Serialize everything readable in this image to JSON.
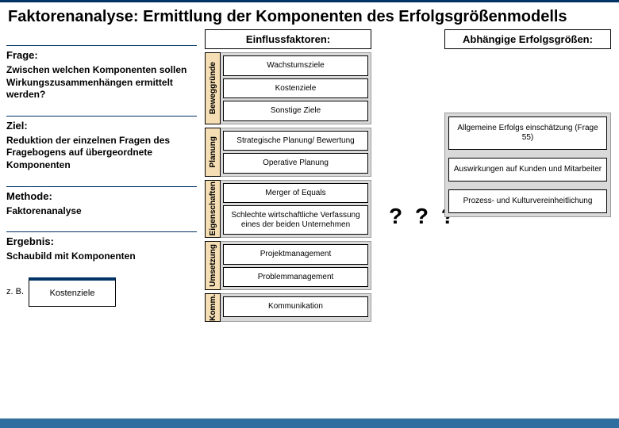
{
  "title": "Faktorenanalyse: Ermittlung der Komponenten des Erfolgsgrößenmodells",
  "left": {
    "frage_head": "Frage:",
    "frage_body": "Zwischen welchen Komponenten sollen Wirkungszusammenhängen ermittelt werden?",
    "ziel_head": "Ziel:",
    "ziel_body": "Reduktion der einzelnen Fragen des Fragebogens auf übergeordnete Komponenten",
    "methode_head": "Methode:",
    "methode_body": "Faktorenanalyse",
    "ergebnis_head": "Ergebnis:",
    "ergebnis_body": "Schaubild mit Komponenten",
    "zb": "z. B.",
    "example": "Kostenziele"
  },
  "mid": {
    "header": "Einflussfaktoren:",
    "groups": [
      {
        "label": "Beweggründe",
        "items": [
          "Wachstumsziele",
          "Kostenziele",
          "Sonstige Ziele"
        ]
      },
      {
        "label": "Planung",
        "items": [
          "Strategische Planung/ Bewertung",
          "Operative Planung"
        ]
      },
      {
        "label": "Eigenschaften",
        "items": [
          "Merger of Equals",
          "Schlechte wirtschaftliche Verfassung eines der beiden Unternehmen"
        ]
      },
      {
        "label": "Umsetzung",
        "items": [
          "Projektmanagement",
          "Problemmanagement"
        ]
      },
      {
        "label": "Komm.",
        "items": [
          "Kommunikation"
        ]
      }
    ]
  },
  "qmarks": "? ? ?",
  "right": {
    "header": "Abhängige Erfolgsgrößen:",
    "items": [
      "Allgemeine Erfolgs einschätzung (Frage 55)",
      "Auswirkungen auf Kunden und Mitarbeiter",
      "Prozess- und Kulturvereinheitlichung"
    ]
  }
}
